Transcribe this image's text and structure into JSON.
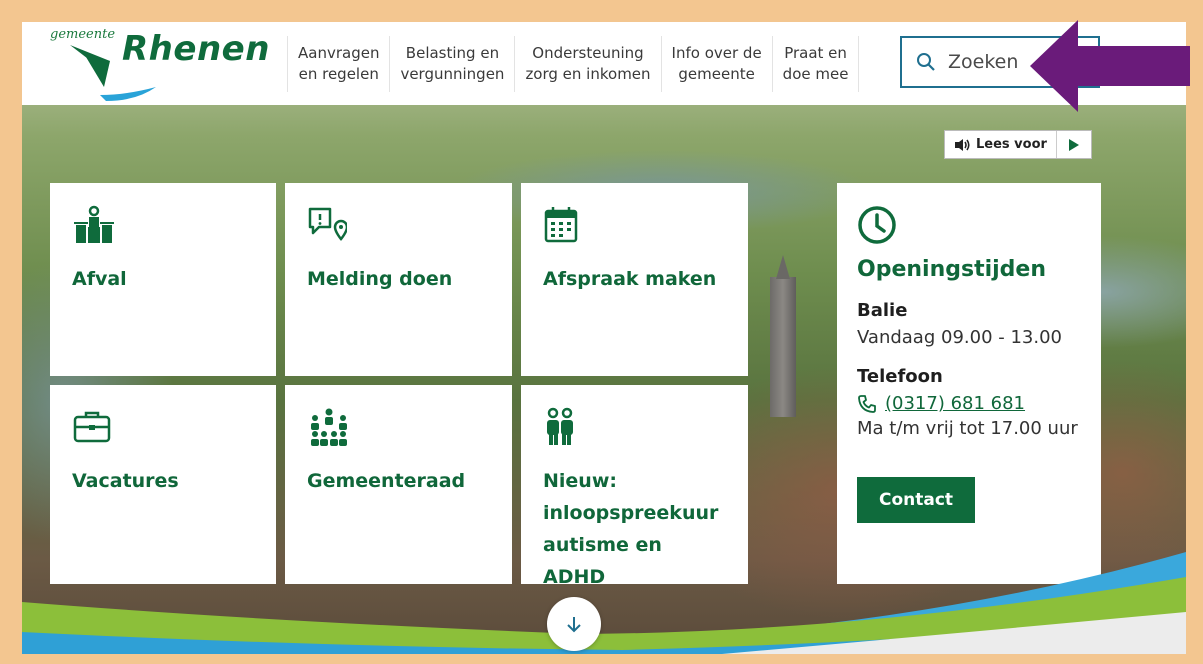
{
  "header": {
    "logo": {
      "small": "gemeente",
      "big": "Rhenen"
    },
    "nav": [
      {
        "label": "Aanvragen\nen regelen"
      },
      {
        "label": "Belasting en\nvergunningen"
      },
      {
        "label": "Ondersteuning\nzorg en inkomen"
      },
      {
        "label": "Info over de\ngemeente"
      },
      {
        "label": "Praat en\ndoe mee"
      }
    ],
    "search": {
      "placeholder": "Zoeken",
      "icon": "search-icon"
    }
  },
  "readaloud": {
    "label": "Lees voor",
    "icons": [
      "speaker-icon",
      "play-icon"
    ]
  },
  "tiles": [
    {
      "label": "Afval",
      "icon": "waste-bins-icon"
    },
    {
      "label": "Melding doen",
      "icon": "report-location-icon"
    },
    {
      "label": "Afspraak maken",
      "icon": "calendar-icon"
    },
    {
      "label": "Vacatures",
      "icon": "briefcase-icon"
    },
    {
      "label": "Gemeenteraad",
      "icon": "council-people-icon"
    },
    {
      "label": "Nieuw: inloopspreekuur autisme en ADHD",
      "icon": "two-people-icon"
    }
  ],
  "hours": {
    "title": "Openingstijden",
    "balie_label": "Balie",
    "balie_text": "Vandaag 09.00 - 13.00",
    "phone_label": "Telefoon",
    "phone_number": "(0317) 681 681",
    "phone_text": "Ma t/m vrij tot 17.00 uur",
    "contact_button": "Contact"
  },
  "colors": {
    "brand_green": "#0f6b3c",
    "search_border": "#1f6f8f",
    "annotation_arrow": "#6a1b7a",
    "page_frame": "#f3c690"
  }
}
